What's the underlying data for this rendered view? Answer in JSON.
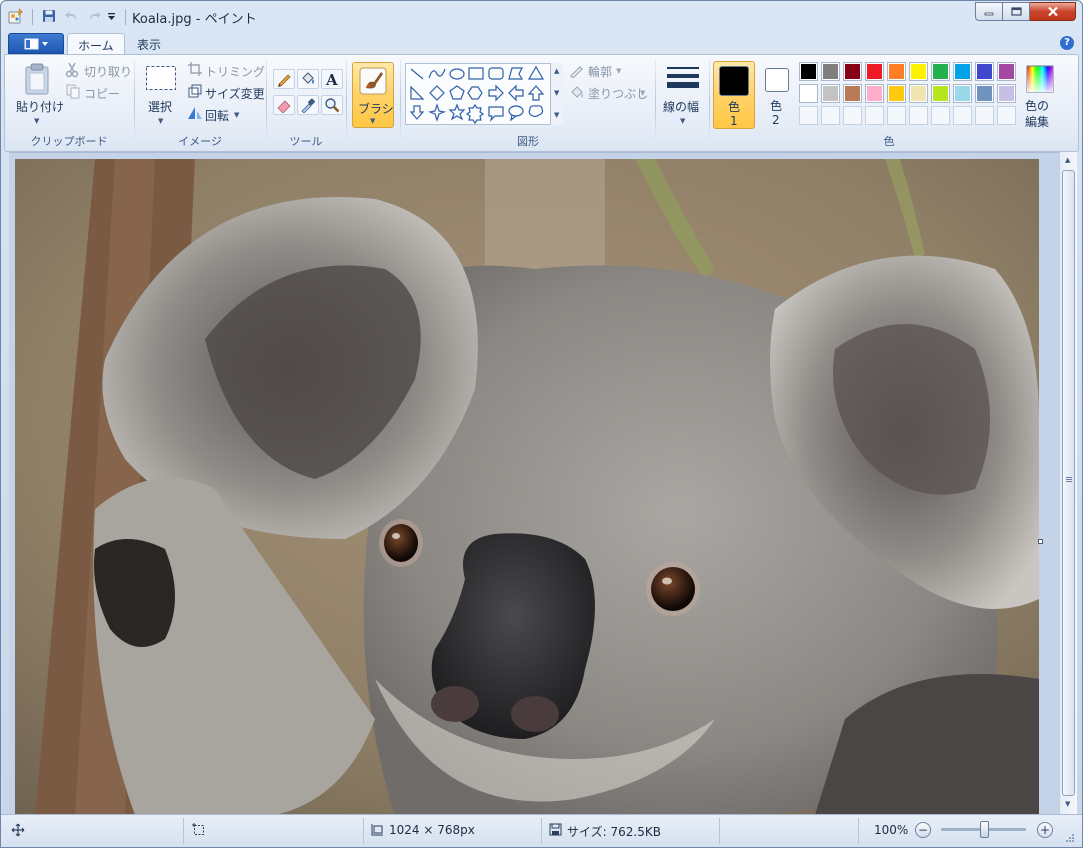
{
  "title": "Koala.jpg - ペイント",
  "tabs": [
    {
      "label": "ホーム"
    },
    {
      "label": "表示"
    }
  ],
  "ribbon": {
    "clipboard": {
      "paste": "貼り付け",
      "cut": "切り取り",
      "copy": "コピー",
      "label": "クリップボード"
    },
    "image": {
      "select": "選択",
      "crop": "トリミング",
      "resize": "サイズ変更",
      "rotate": "回転",
      "label": "イメージ"
    },
    "tools": {
      "label": "ツール"
    },
    "brush": {
      "label": "ブラシ"
    },
    "shapes": {
      "outline": "輪郭",
      "fill": "塗りつぶし",
      "label": "図形"
    },
    "size": {
      "label": "線の幅"
    },
    "colors": {
      "color1_char": "色",
      "color1_num": "1",
      "color2_char": "色",
      "color2_num": "2",
      "edit_line1": "色の",
      "edit_line2": "編集",
      "label": "色",
      "color1_value": "#000000",
      "color2_value": "#ffffff",
      "palette_row1": [
        "#000000",
        "#7f7f7f",
        "#880015",
        "#ed1c24",
        "#ff7f27",
        "#fff200",
        "#22b14c",
        "#00a2e8",
        "#3f48cc",
        "#a349a4"
      ],
      "palette_row2": [
        "#ffffff",
        "#c3c3c3",
        "#b97a57",
        "#ffaec9",
        "#ffc90e",
        "#efe4b0",
        "#b5e61d",
        "#99d9ea",
        "#7092be",
        "#c8bfe7"
      ]
    }
  },
  "status": {
    "dimensions": "1024 × 768px",
    "file_size": "サイズ: 762.5KB",
    "zoom": "100%",
    "zoom_level": 0.5
  }
}
